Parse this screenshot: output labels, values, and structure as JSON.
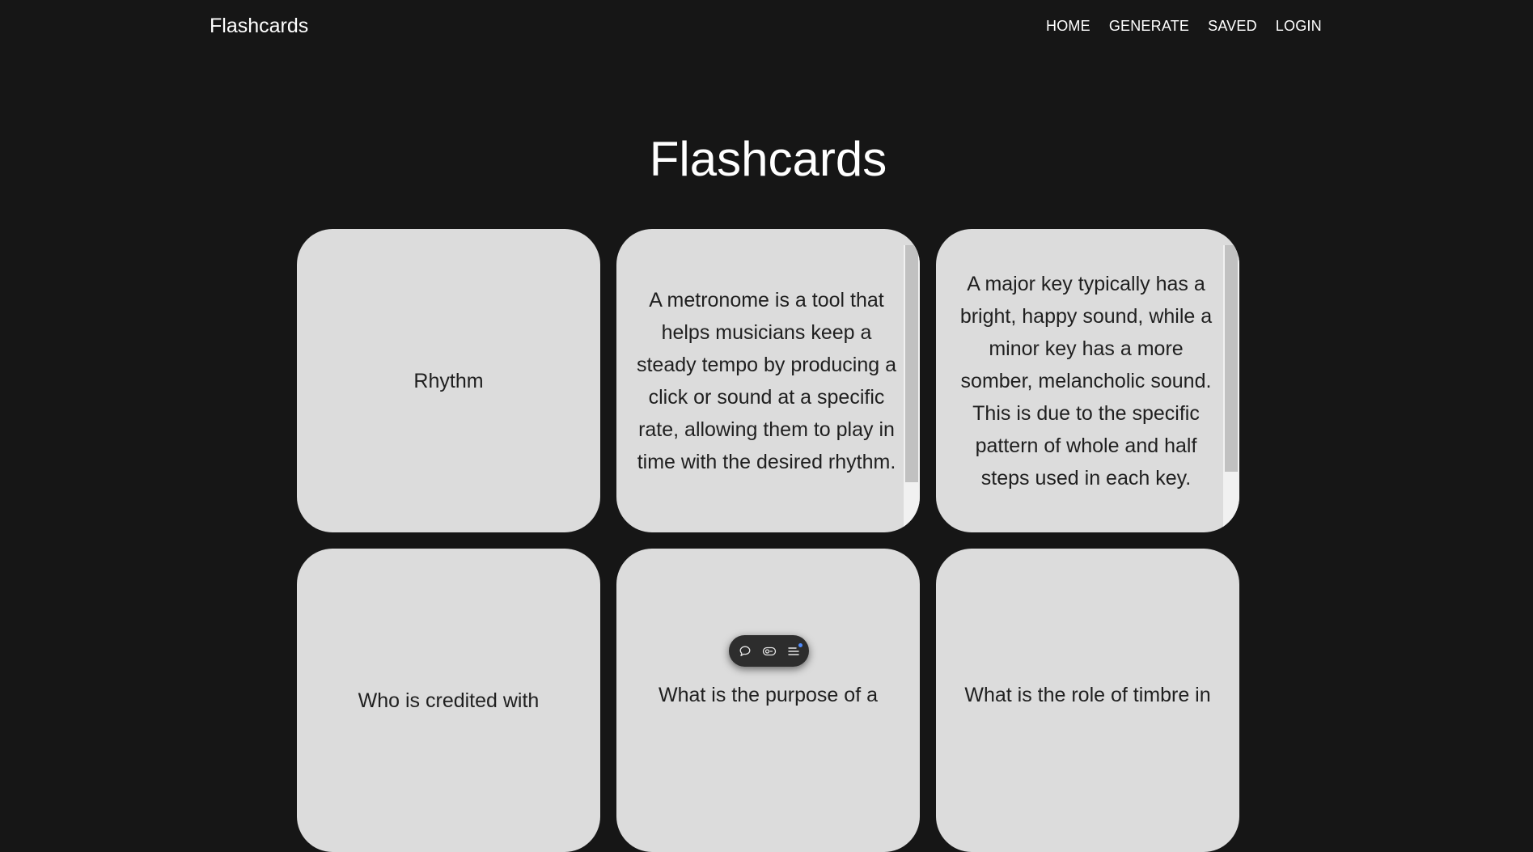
{
  "nav": {
    "brand": "Flashcards",
    "links": [
      "HOME",
      "GENERATE",
      "SAVED",
      "LOGIN"
    ]
  },
  "page": {
    "title": "Flashcards"
  },
  "cards": [
    {
      "text": "Rhythm",
      "scroll_position": null
    },
    {
      "text": "A metronome is a tool that helps musicians keep a steady tempo by producing a click or sound at a specific rate, allowing them to play in time with the desired rhythm.",
      "scroll_position": 0
    },
    {
      "text": "A major key typically has a bright, happy sound, while a minor key has a more somber, melancholic sound. This is due to the specific pattern of whole and half steps used in each key.",
      "scroll_position": 0
    },
    {
      "text": "Who is credited with",
      "scroll_position": null
    },
    {
      "text": "What is the purpose of a",
      "scroll_position": null
    },
    {
      "text": "What is the role of timbre in",
      "scroll_position": null
    }
  ],
  "toolbar": {
    "icons": [
      "comment-icon",
      "toggle-icon",
      "menu-list-icon"
    ],
    "accent_color": "#4f8cff"
  },
  "colors": {
    "background": "#161616",
    "card": "#dcdcdc",
    "card_text": "#1f1f1f"
  }
}
